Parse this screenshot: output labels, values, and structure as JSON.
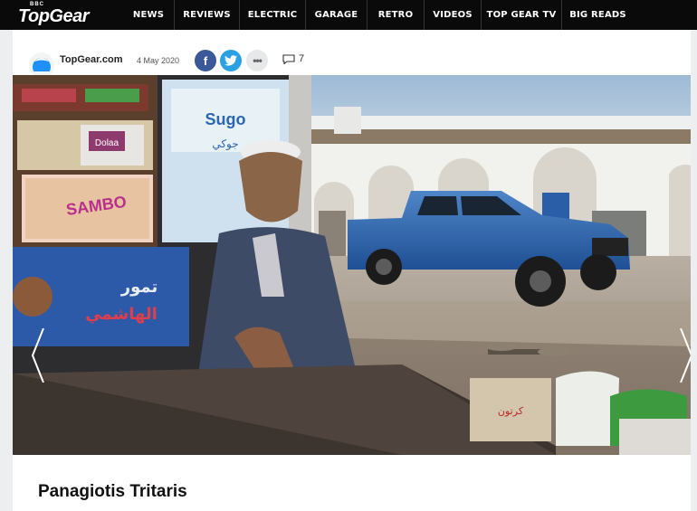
{
  "brand": {
    "small": "BBC",
    "name": "TopGear"
  },
  "nav": [
    {
      "label": "NEWS",
      "w": 56
    },
    {
      "label": "REVIEWS",
      "w": 72
    },
    {
      "label": "ELECTRIC",
      "w": 73
    },
    {
      "label": "GARAGE",
      "w": 68
    },
    {
      "label": "RETRO",
      "w": 63
    },
    {
      "label": "VIDEOS",
      "w": 63
    },
    {
      "label": "TOP GEAR TV",
      "w": 89
    },
    {
      "label": "BIG READS",
      "w": 80
    }
  ],
  "article": {
    "author": "TopGear.com",
    "date": "4 May 2020",
    "share_fb": "f",
    "share_more": "•••",
    "comments_count": "7",
    "caption": "Panagiotis Tritaris"
  },
  "photo": {
    "signs": {
      "sambo": "SAMBO",
      "dolaa": "Dolaa",
      "sugar": "Sugo",
      "arabic_1": "تمور",
      "arabic_2": "الهاشمي",
      "arabic_3": "جوكي",
      "crate": "كرتون"
    }
  }
}
